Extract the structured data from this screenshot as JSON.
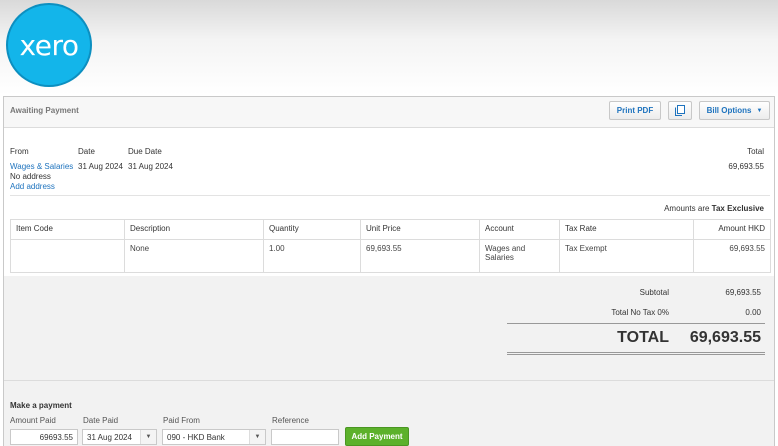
{
  "brand": {
    "logo_text": "xero",
    "color": "#13b5ea"
  },
  "header": {
    "status": "Awaiting Payment",
    "print_pdf": "Print PDF",
    "bill_options": "Bill Options"
  },
  "bill": {
    "from_label": "From",
    "date_label": "Date",
    "due_label": "Due Date",
    "total_label": "Total",
    "from_name": "Wages & Salaries",
    "date": "31 Aug 2024",
    "due_date": "31 Aug 2024",
    "total": "69,693.55",
    "no_address": "No address",
    "add_address": "Add address",
    "amounts_prefix": "Amounts are",
    "amounts_mode": "Tax Exclusive"
  },
  "table": {
    "headers": [
      "Item Code",
      "Description",
      "Quantity",
      "Unit Price",
      "Account",
      "Tax Rate",
      "Amount HKD"
    ],
    "rows": [
      [
        "",
        "None",
        "1.00",
        "69,693.55",
        "Wages and Salaries",
        "Tax Exempt",
        "69,693.55"
      ]
    ]
  },
  "totals": {
    "subtotal_label": "Subtotal",
    "subtotal": "69,693.55",
    "tax_label": "Total No Tax 0%",
    "tax": "0.00",
    "total_label": "TOTAL",
    "total": "69,693.55"
  },
  "payment": {
    "title": "Make a payment",
    "amount_label": "Amount Paid",
    "date_label": "Date Paid",
    "from_label": "Paid From",
    "ref_label": "Reference",
    "amount": "69693.55",
    "date": "31 Aug 2024",
    "from": "090 - HKD Bank",
    "reference": "",
    "button": "Add Payment"
  }
}
